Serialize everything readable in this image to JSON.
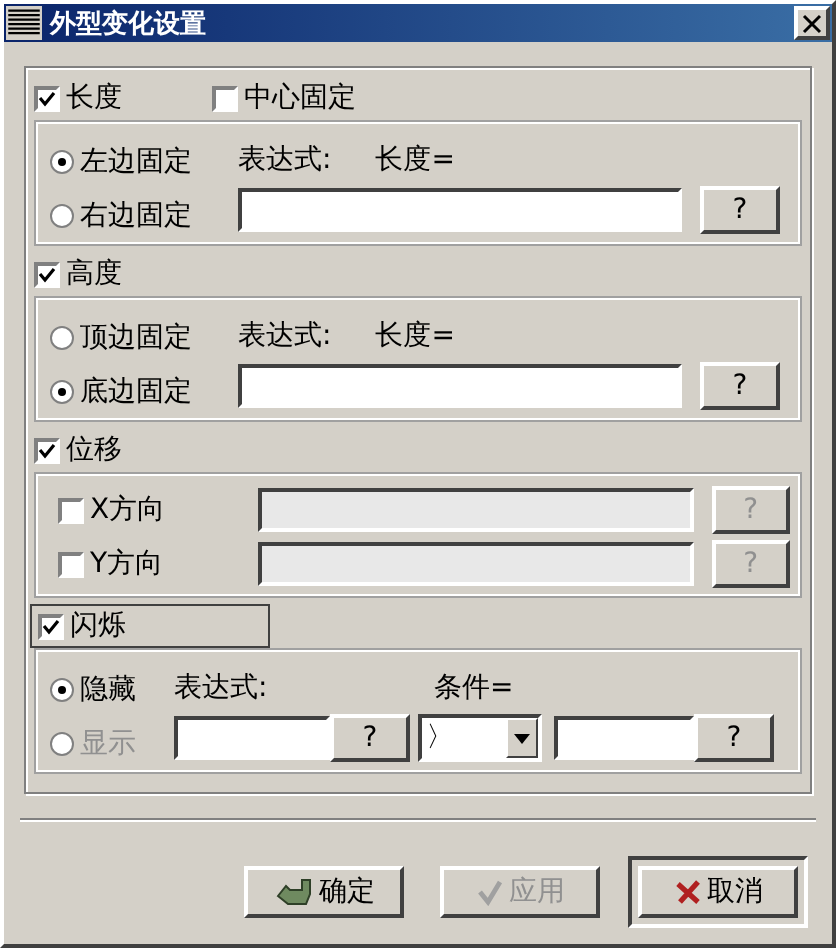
{
  "window": {
    "title": "外型变化设置"
  },
  "length": {
    "label": "长度",
    "checked": true,
    "center": {
      "label": "中心固定",
      "checked": false
    },
    "anchors": [
      {
        "label": "左边固定",
        "selected": true
      },
      {
        "label": "右边固定",
        "selected": false
      }
    ],
    "expression_label": "表达式:",
    "target_label": "长度=",
    "help": "?"
  },
  "height": {
    "label": "高度",
    "checked": true,
    "anchors": [
      {
        "label": "顶边固定",
        "selected": false
      },
      {
        "label": "底边固定",
        "selected": true
      }
    ],
    "expression_label": "表达式:",
    "target_label": "长度=",
    "help": "?"
  },
  "displacement": {
    "label": "位移",
    "checked": true,
    "directions": [
      {
        "label": "X方向",
        "checked": false,
        "disabled": true,
        "help": "?"
      },
      {
        "label": "Y方向",
        "checked": false,
        "disabled": true,
        "help": "?"
      }
    ]
  },
  "blink": {
    "label": "闪烁",
    "checked": true,
    "modes": [
      {
        "label": "隐藏",
        "selected": true,
        "disabled": false
      },
      {
        "label": "显示",
        "selected": false,
        "disabled": true
      }
    ],
    "expression_label": "表达式:",
    "expression_help": "?",
    "condition_label": "条件=",
    "operator": "〉",
    "condition_help": "?"
  },
  "buttons": [
    {
      "kind": "ok",
      "label": "确定",
      "disabled": false,
      "focused": false
    },
    {
      "kind": "apply",
      "label": "应用",
      "disabled": true,
      "focused": false
    },
    {
      "kind": "cancel",
      "label": "取消",
      "disabled": false,
      "focused": true
    }
  ]
}
